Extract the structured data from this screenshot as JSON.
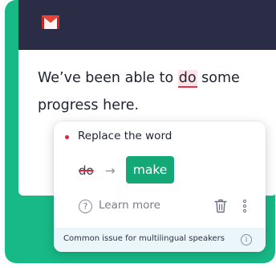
{
  "email": {
    "text_before": "We’ve been able to ",
    "flagged_word": "do",
    "text_after": " some progress here."
  },
  "suggestion": {
    "title": "Replace the word",
    "original_word": "do",
    "arrow": "→",
    "replacement": "make",
    "learn_more_icon": "?",
    "learn_more": "Learn more",
    "footer_note": "Common issue for multilingual speakers",
    "info_icon": "i"
  },
  "icons": {
    "app": "gmail-icon",
    "delete": "trash-icon",
    "menu": "more-vertical-icon"
  },
  "colors": {
    "background": "#17b987",
    "header": "#2a2d45",
    "accent_green": "#15a877",
    "error_red": "#e0243d",
    "highlight": "#ffe3e7",
    "footer": "#ebf6fb"
  }
}
